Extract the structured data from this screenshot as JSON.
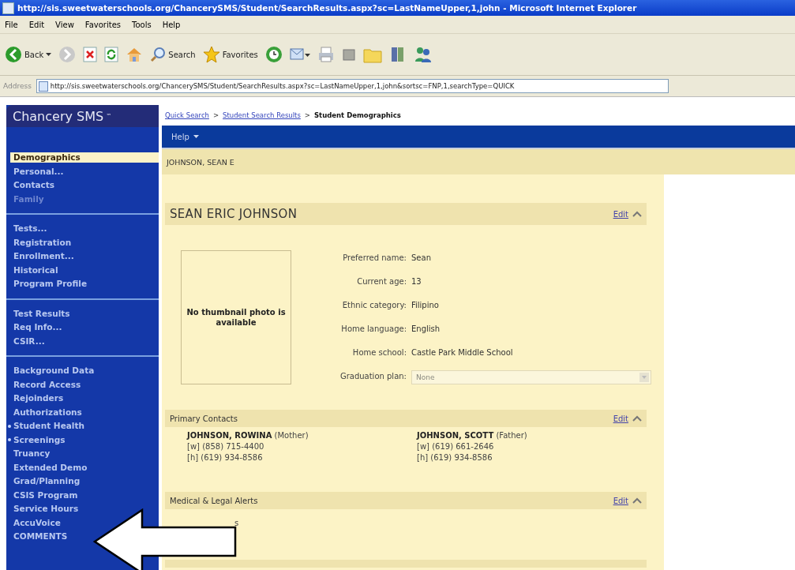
{
  "window": {
    "title": "http://sis.sweetwaterschools.org/ChancerySMS/Student/SearchResults.aspx?sc=LastNameUpper,1,john - Microsoft Internet Explorer"
  },
  "menu": [
    "File",
    "Edit",
    "View",
    "Favorites",
    "Tools",
    "Help"
  ],
  "toolbar": [
    {
      "kind": "back",
      "label": "Back"
    },
    {
      "kind": "forward"
    },
    {
      "kind": "stop"
    },
    {
      "kind": "refresh"
    },
    {
      "kind": "home"
    },
    {
      "kind": "search",
      "label": "Search"
    },
    {
      "kind": "favorites",
      "label": "Favorites"
    },
    {
      "kind": "history"
    },
    {
      "kind": "mail"
    },
    {
      "kind": "print"
    },
    {
      "kind": "edit"
    },
    {
      "kind": "folder"
    },
    {
      "kind": "book"
    },
    {
      "kind": "messenger"
    }
  ],
  "address": {
    "label": "Address",
    "value": "http://sis.sweetwaterschools.org/ChancerySMS/Student/SearchResults.aspx?sc=LastNameUpper,1,john&sortsc=FNP,1,searchType=QUICK"
  },
  "sidebar": {
    "logo": "Chancery SMS",
    "logo_mark": "™",
    "groups": [
      [
        {
          "label": "Demographics",
          "selected": true,
          "disabled": false,
          "bullet": false
        },
        {
          "label": "Personal...",
          "selected": false,
          "disabled": false,
          "bullet": false
        },
        {
          "label": "Contacts",
          "selected": false,
          "disabled": false,
          "bullet": false
        },
        {
          "label": "Family",
          "selected": false,
          "disabled": true,
          "bullet": false
        }
      ],
      [
        {
          "label": "Tests...",
          "selected": false,
          "disabled": false,
          "bullet": false
        },
        {
          "label": "Registration",
          "selected": false,
          "disabled": false,
          "bullet": false
        },
        {
          "label": "Enrollment...",
          "selected": false,
          "disabled": false,
          "bullet": false
        },
        {
          "label": "Historical",
          "selected": false,
          "disabled": false,
          "bullet": false
        },
        {
          "label": "Program Profile",
          "selected": false,
          "disabled": false,
          "bullet": false
        }
      ],
      [
        {
          "label": "Test Results",
          "selected": false,
          "disabled": false,
          "bullet": false
        },
        {
          "label": "Req Info...",
          "selected": false,
          "disabled": false,
          "bullet": false
        },
        {
          "label": "CSIR...",
          "selected": false,
          "disabled": false,
          "bullet": false
        }
      ],
      [
        {
          "label": "Background Data",
          "selected": false,
          "disabled": false,
          "bullet": false
        },
        {
          "label": "Record Access",
          "selected": false,
          "disabled": false,
          "bullet": false
        },
        {
          "label": "Rejoinders",
          "selected": false,
          "disabled": false,
          "bullet": false
        },
        {
          "label": "Authorizations",
          "selected": false,
          "disabled": false,
          "bullet": false
        },
        {
          "label": "Student Health",
          "selected": false,
          "disabled": false,
          "bullet": true
        },
        {
          "label": "Screenings",
          "selected": false,
          "disabled": false,
          "bullet": true
        },
        {
          "label": "Truancy",
          "selected": false,
          "disabled": false,
          "bullet": false
        },
        {
          "label": "Extended Demo",
          "selected": false,
          "disabled": false,
          "bullet": false
        },
        {
          "label": "Grad/Planning",
          "selected": false,
          "disabled": false,
          "bullet": false
        },
        {
          "label": "CSIS Program",
          "selected": false,
          "disabled": false,
          "bullet": false
        },
        {
          "label": "Service Hours",
          "selected": false,
          "disabled": false,
          "bullet": false
        },
        {
          "label": "AccuVoice",
          "selected": false,
          "disabled": false,
          "bullet": false
        },
        {
          "label": "COMMENTS",
          "selected": false,
          "disabled": false,
          "bullet": false
        }
      ]
    ]
  },
  "breadcrumb": [
    {
      "kind": "link",
      "label": "Quick Search"
    },
    {
      "kind": "sep",
      "label": ">"
    },
    {
      "kind": "link",
      "label": "Student Search Results"
    },
    {
      "kind": "sep",
      "label": ">"
    },
    {
      "kind": "current",
      "label": "Student Demographics"
    }
  ],
  "page_menu": [
    {
      "label": "Help",
      "dropdown": true
    }
  ],
  "student_banner": "JOHNSON, SEAN E",
  "sections": [
    {
      "kind": "demographics",
      "title": "SEAN ERIC JOHNSON",
      "edit": "Edit",
      "expanded": true,
      "photo_text": "No thumbnail photo is available",
      "fields": [
        {
          "kind": "text",
          "label": "Preferred name:",
          "value": "Sean"
        },
        {
          "kind": "text",
          "label": "Current age:",
          "value": "13"
        },
        {
          "kind": "text",
          "label": "Ethnic category:",
          "value": "Filipino"
        },
        {
          "kind": "text",
          "label": "Home language:",
          "value": "English"
        },
        {
          "kind": "text",
          "label": "Home school:",
          "value": "Castle Park Middle School"
        },
        {
          "kind": "select",
          "label": "Graduation plan:",
          "value": "None",
          "disabled": true
        }
      ]
    },
    {
      "kind": "contacts",
      "title": "Primary Contacts",
      "edit": "Edit",
      "expanded": true,
      "contacts": [
        {
          "name": "JOHNSON, ROWINA",
          "relation": "(Mother)",
          "phones": [
            "[w] (858) 715-4400",
            "[h] (619) 934-8586"
          ]
        },
        {
          "name": "JOHNSON, SCOTT",
          "relation": "(Father)",
          "phones": [
            "[w] (619) 661-2646",
            "[h] (619) 934-8586"
          ]
        }
      ]
    },
    {
      "kind": "alerts",
      "title": "Medical & Legal Alerts",
      "edit": "Edit",
      "expanded": true,
      "text": "s"
    },
    {
      "kind": "blank"
    }
  ],
  "annotation": {
    "kind": "arrow"
  }
}
